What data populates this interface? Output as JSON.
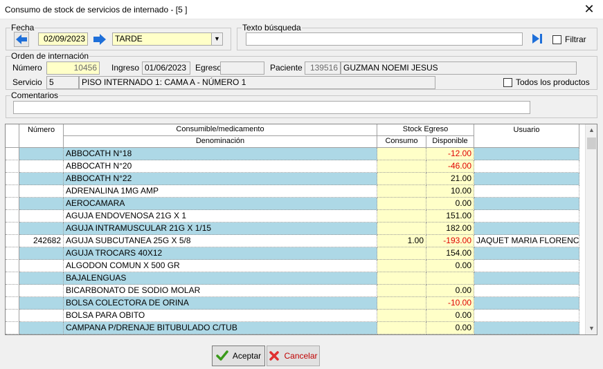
{
  "window": {
    "title": "Consumo de stock de servicios de internado - [5 ]",
    "close_icon": "close-icon"
  },
  "fecha": {
    "legend": "Fecha",
    "date": "02/09/2023",
    "turno": "TARDE",
    "prev_icon": "arrow-left-icon",
    "next_icon": "arrow-right-icon"
  },
  "busqueda": {
    "legend": "Texto búsqueda",
    "value": "",
    "go_icon": "skip-next-icon",
    "filtrar_label": "Filtrar",
    "filtrar_checked": false
  },
  "orden": {
    "legend": "Orden de internación",
    "numero_label": "Número",
    "numero": "10456",
    "ingreso_label": "Ingreso",
    "ingreso": "01/06/2023",
    "egreso_label": "Egreso",
    "egreso": "",
    "paciente_label": "Paciente",
    "paciente_id": "139516",
    "paciente_nombre": "GUZMAN NOEMI JESUS",
    "servicio_label": "Servicio",
    "servicio_id": "5",
    "servicio_nombre": "PISO INTERNADO 1: CAMA A - NÚMERO 1",
    "todos_label": "Todos los productos",
    "todos_checked": false
  },
  "comentarios": {
    "legend": "Comentarios",
    "value": ""
  },
  "grid": {
    "headers": {
      "numero": "Número",
      "consumible": "Consumible/medicamento",
      "denominacion": "Denominación",
      "stock_egreso": "Stock Egreso",
      "consumo": "Consumo",
      "disponible": "Disponible",
      "usuario": "Usuario"
    },
    "rows": [
      {
        "numero": "",
        "denominacion": "ABBOCATH N°18",
        "consumo": "",
        "disponible": "-12.00",
        "usuario": ""
      },
      {
        "numero": "",
        "denominacion": "ABBOCATH N°20",
        "consumo": "",
        "disponible": "-46.00",
        "usuario": ""
      },
      {
        "numero": "",
        "denominacion": "ABBOCATH N°22",
        "consumo": "",
        "disponible": "21.00",
        "usuario": ""
      },
      {
        "numero": "",
        "denominacion": "ADRENALINA 1MG AMP",
        "consumo": "",
        "disponible": "10.00",
        "usuario": ""
      },
      {
        "numero": "",
        "denominacion": "AEROCAMARA",
        "consumo": "",
        "disponible": "0.00",
        "usuario": ""
      },
      {
        "numero": "",
        "denominacion": "AGUJA ENDOVENOSA 21G X 1",
        "consumo": "",
        "disponible": "151.00",
        "usuario": ""
      },
      {
        "numero": "",
        "denominacion": "AGUJA INTRAMUSCULAR 21G X 1/15",
        "consumo": "",
        "disponible": "182.00",
        "usuario": ""
      },
      {
        "numero": "242682",
        "denominacion": "AGUJA SUBCUTANEA 25G X 5/8",
        "consumo": "1.00",
        "disponible": "-193.00",
        "usuario": "JAQUET MARIA FLORENCIA"
      },
      {
        "numero": "",
        "denominacion": "AGUJA TROCARS 40X12",
        "consumo": "",
        "disponible": "154.00",
        "usuario": ""
      },
      {
        "numero": "",
        "denominacion": "ALGODON COMUN X 500 GR",
        "consumo": "",
        "disponible": "0.00",
        "usuario": ""
      },
      {
        "numero": "",
        "denominacion": "BAJALENGUAS",
        "consumo": "",
        "disponible": "",
        "usuario": ""
      },
      {
        "numero": "",
        "denominacion": "BICARBONATO DE SODIO MOLAR",
        "consumo": "",
        "disponible": "0.00",
        "usuario": ""
      },
      {
        "numero": "",
        "denominacion": "BOLSA COLECTORA DE ORINA",
        "consumo": "",
        "disponible": "-10.00",
        "usuario": ""
      },
      {
        "numero": "",
        "denominacion": "BOLSA PARA OBITO",
        "consumo": "",
        "disponible": "0.00",
        "usuario": ""
      },
      {
        "numero": "",
        "denominacion": "CAMPANA P/DRENAJE BITUBULADO C/TUB",
        "consumo": "",
        "disponible": "0.00",
        "usuario": ""
      }
    ]
  },
  "buttons": {
    "aceptar": "Aceptar",
    "aceptar_icon": "checkmark-icon",
    "cancelar": "Cancelar",
    "cancelar_icon": "x-icon"
  },
  "colors": {
    "row_alt": "#add8e6",
    "editable": "#ffffc8",
    "negative": "#e00000",
    "accent_arrow": "#1e6fd9"
  }
}
